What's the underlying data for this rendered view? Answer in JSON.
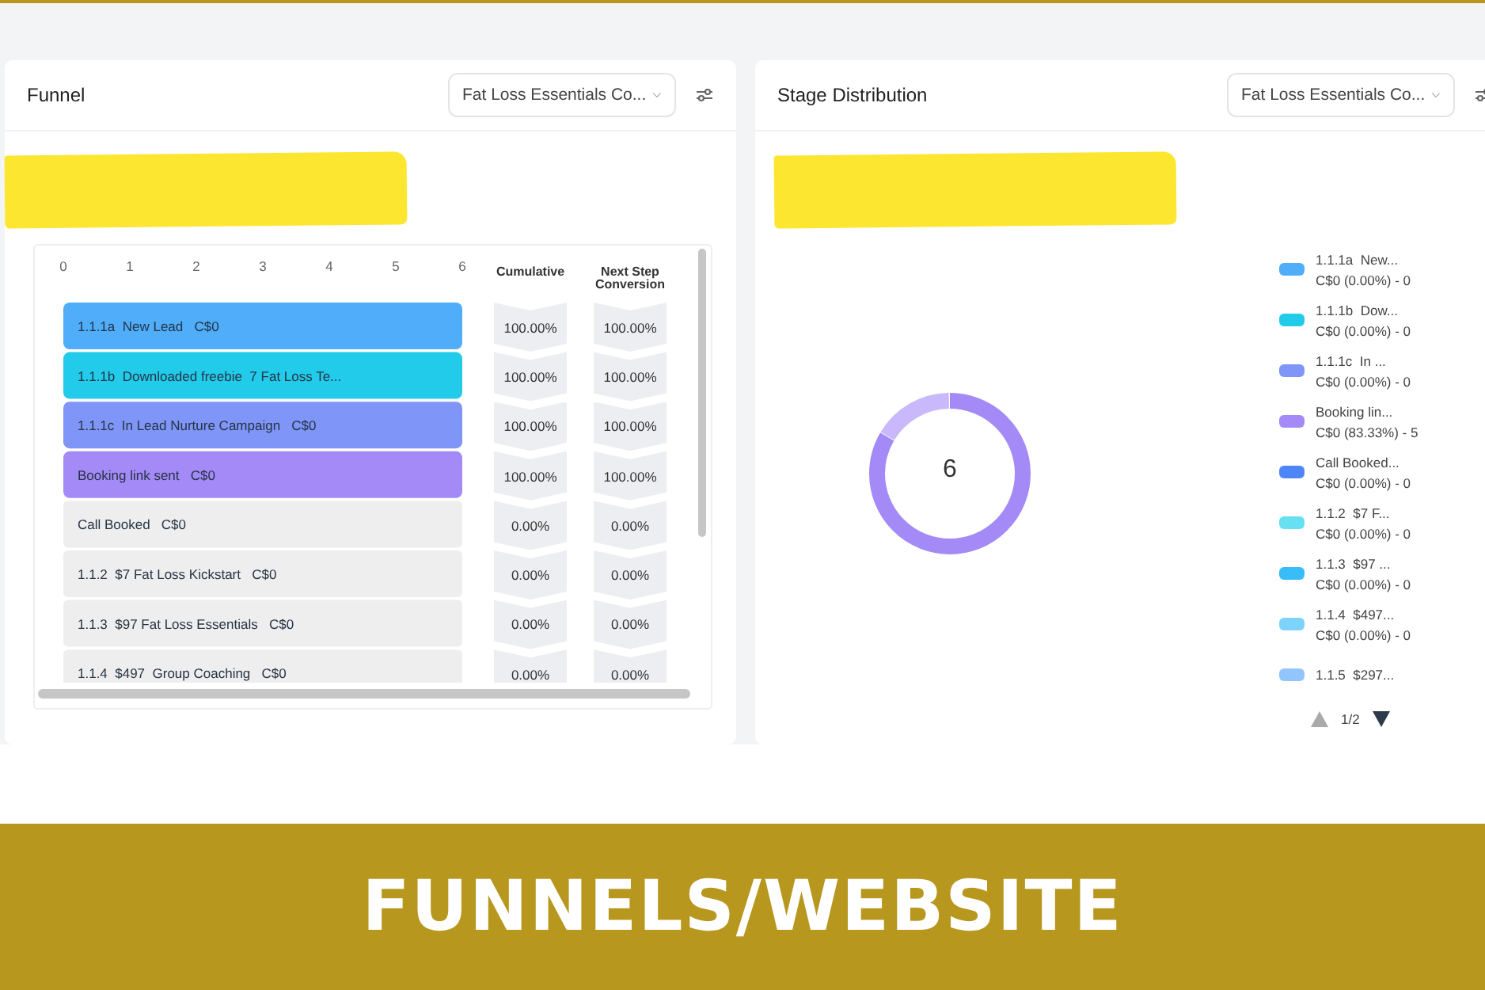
{
  "funnel": {
    "title": "Funnel",
    "dropdown": "Fat Loss Essentials Co...",
    "columns": [
      "Cumulative",
      "Next Step Conversion"
    ],
    "rows": [
      {
        "color": "#4fadfa",
        "cumulative": "100.00%",
        "next_step": "100.00%"
      },
      {
        "color": "#22cbea",
        "cumulative": "100.00%",
        "next_step": "100.00%"
      },
      {
        "color": "#7f95f7",
        "cumulative": "100.00%",
        "next_step": "100.00%"
      },
      {
        "color": "#a48af7",
        "cumulative": "100.00%",
        "next_step": "100.00%"
      },
      {
        "cumulative": "0.00%",
        "next_step": "0.00%"
      },
      {
        "cumulative": "0.00%",
        "next_step": "0.00%"
      },
      {
        "cumulative": "0.00%",
        "next_step": "0.00%"
      },
      {
        "cumulative": "0.00%",
        "next_step": "0.00%"
      }
    ],
    "chart_data": {
      "type": "bar",
      "orientation": "horizontal",
      "categories": [
        "1.1.1a  New Lead   C$0",
        "1.1.1b  Downloaded freebie  7 Fat Loss Te...",
        "1.1.1c  In Lead Nurture Campaign   C$0",
        "Booking link sent   C$0",
        "Call Booked   C$0",
        "1.1.2  $7 Fat Loss Kickstart   C$0",
        "1.1.3  $97 Fat Loss Essentials   C$0",
        "1.1.4  $497  Group Coaching   C$0"
      ],
      "values": [
        6,
        6,
        6,
        6,
        0,
        0,
        0,
        0
      ],
      "xlim": [
        0,
        6
      ],
      "xticks": [
        0,
        1,
        2,
        3,
        4,
        5,
        6
      ]
    }
  },
  "stage_distribution": {
    "title": "Stage Distribution",
    "dropdown": "Fat Loss Essentials Co...",
    "total": "6",
    "legend": [
      {
        "name": "1.1.1a  New...",
        "value": "C$0 (0.00%) - 0",
        "color": "#4fadfa"
      },
      {
        "name": "1.1.1b  Dow...",
        "value": "C$0 (0.00%) - 0",
        "color": "#22cbea"
      },
      {
        "name": "1.1.1c  In ...",
        "value": "C$0 (0.00%) - 0",
        "color": "#7f95f7"
      },
      {
        "name": "Booking lin...",
        "value": "C$0 (83.33%) - 5",
        "color": "#a48af7"
      },
      {
        "name": "Call Booked...",
        "value": "C$0 (0.00%) - 0",
        "color": "#4f86f7"
      },
      {
        "name": "1.1.2  $7 F...",
        "value": "C$0 (0.00%) - 0",
        "color": "#67e0f2"
      },
      {
        "name": "1.1.3  $97 ...",
        "value": "C$0 (0.00%) - 0",
        "color": "#38bdf8"
      },
      {
        "name": "1.1.4  $497...",
        "value": "C$0 (0.00%) - 0",
        "color": "#7dd3fc"
      },
      {
        "name": "1.1.5  $297...",
        "color": "#93c5fd"
      }
    ],
    "pager": {
      "label": "1/2",
      "prev_disabled": true,
      "next_disabled": false
    }
  },
  "banner": {
    "title": "FUNNELS/WEBSITE"
  }
}
